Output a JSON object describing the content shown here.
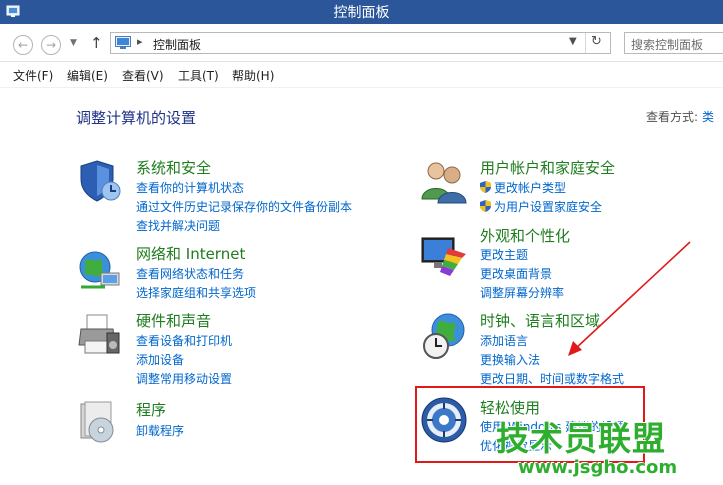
{
  "window": {
    "title": "控制面板"
  },
  "address": {
    "path": "控制面板",
    "separator": "▸"
  },
  "search": {
    "placeholder": "搜索控制面板"
  },
  "menu": [
    "文件(F)",
    "编辑(E)",
    "查看(V)",
    "工具(T)",
    "帮助(H)"
  ],
  "main": {
    "heading": "调整计算机的设置",
    "view_by_label": "查看方式:",
    "view_by_value": "类"
  },
  "categories": [
    {
      "title": "系统和安全",
      "icon": "shield-icon",
      "links": [
        "查看你的计算机状态",
        "通过文件历史记录保存你的文件备份副本",
        "查找并解决问题"
      ]
    },
    {
      "title": "网络和 Internet",
      "icon": "network-globe-icon",
      "links": [
        "查看网络状态和任务",
        "选择家庭组和共享选项"
      ]
    },
    {
      "title": "硬件和声音",
      "icon": "printer-icon",
      "links": [
        "查看设备和打印机",
        "添加设备",
        "调整常用移动设置"
      ]
    },
    {
      "title": "程序",
      "icon": "programs-disc-icon",
      "links": [
        "卸载程序"
      ]
    },
    {
      "title": "用户帐户和家庭安全",
      "icon": "users-icon",
      "links": [
        "更改帐户类型",
        "为用户设置家庭安全"
      ]
    },
    {
      "title": "外观和个性化",
      "icon": "monitor-palette-icon",
      "links": [
        "更改主题",
        "更改桌面背景",
        "调整屏幕分辨率"
      ]
    },
    {
      "title": "时钟、语言和区域",
      "icon": "clock-globe-icon",
      "links": [
        "添加语言",
        "更换输入法",
        "更改日期、时间或数字格式"
      ]
    },
    {
      "title": "轻松使用",
      "icon": "ease-of-access-icon",
      "links": [
        "使用 Windows 建议的设置",
        "优化视觉显示"
      ]
    }
  ],
  "annotations": {
    "highlight_color": "#e01a1a",
    "arrow_color": "#e01a1a"
  },
  "watermark": {
    "text": "技术员联盟",
    "url": "www.jsgho.com",
    "color": "#2eae2e"
  },
  "colors": {
    "titlebar": "#2b579a",
    "category_title": "#1e7d1e",
    "link": "#0066cc",
    "heading": "#1e3287"
  }
}
